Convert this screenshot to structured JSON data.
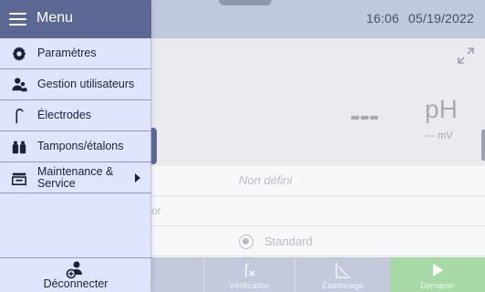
{
  "header": {
    "time": "16:06",
    "date": "05/19/2022"
  },
  "measurement": {
    "value": "---",
    "unit": "pH",
    "sub_value": "--- mV"
  },
  "settings_rows": {
    "row1_value": "Non défini",
    "row2_fragment": "sor",
    "method_option": "Standard"
  },
  "bottom_bar": {
    "verification_label": "Vérification",
    "calibration_label": "Étalonnage",
    "start_label": "Démarrer"
  },
  "menu": {
    "title": "Menu",
    "items": [
      {
        "label": "Paramètres",
        "icon": "gear-icon"
      },
      {
        "label": "Gestion utilisateurs",
        "icon": "users-icon"
      },
      {
        "label": "Électrodes",
        "icon": "electrode-icon"
      },
      {
        "label": "Tampons/étalons",
        "icon": "buffer-bottles-icon"
      },
      {
        "label_line1": "Maintenance &",
        "label_line2": "Service",
        "icon": "maintenance-icon"
      }
    ],
    "logout_label": "Déconnecter"
  },
  "colors": {
    "menu_header": "#5b6893",
    "menu_bg": "#dfe5fd",
    "start_button": "#a6d9a5"
  }
}
